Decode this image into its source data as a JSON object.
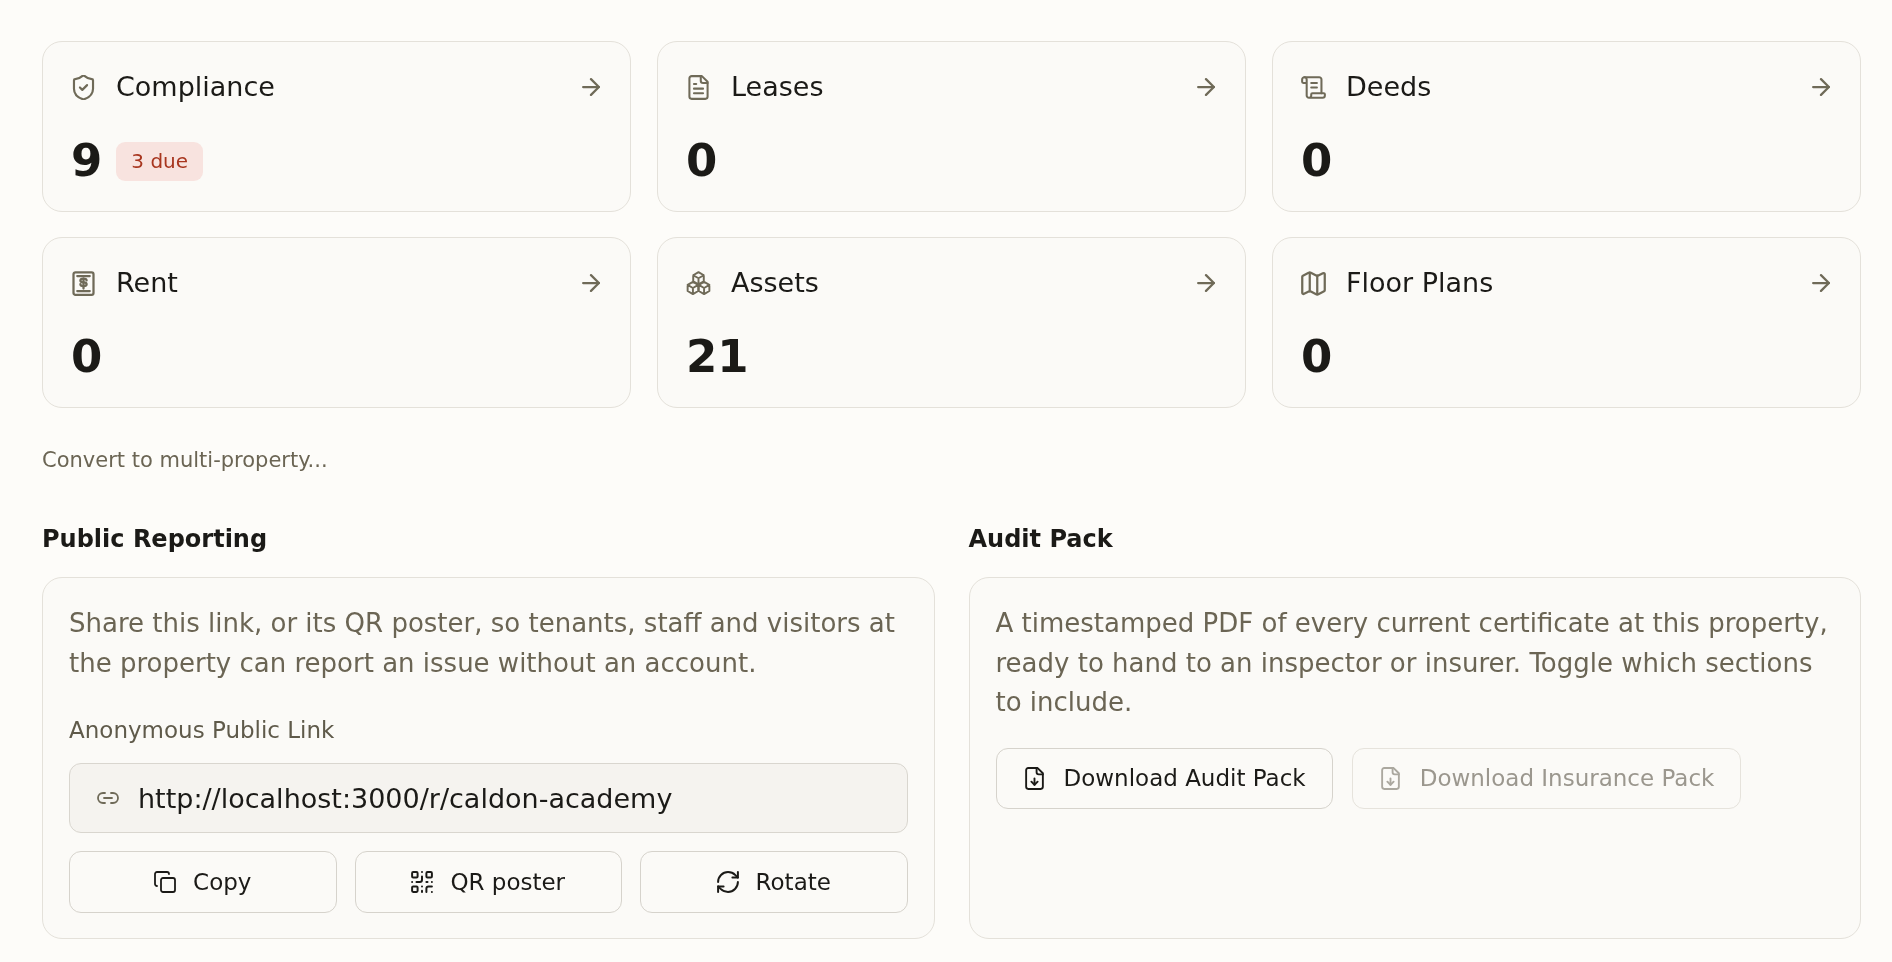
{
  "stat_cards": [
    {
      "title": "Compliance",
      "count": "9",
      "badge": "3 due"
    },
    {
      "title": "Leases",
      "count": "0"
    },
    {
      "title": "Deeds",
      "count": "0"
    },
    {
      "title": "Rent",
      "count": "0"
    },
    {
      "title": "Assets",
      "count": "21"
    },
    {
      "title": "Floor Plans",
      "count": "0"
    }
  ],
  "convert_link": "Convert to multi-property...",
  "public_reporting": {
    "heading": "Public Reporting",
    "description": "Share this link, or its QR poster, so tenants, staff and visitors at the property can report an issue without an account.",
    "field_label": "Anonymous Public Link",
    "link_field": {
      "value": "http://localhost:3000/r/caldon-academy"
    },
    "buttons": [
      {
        "label": "Copy"
      },
      {
        "label": "QR poster"
      },
      {
        "label": "Rotate"
      }
    ]
  },
  "audit_pack": {
    "heading": "Audit Pack",
    "description": "A timestamped PDF of every current certificate at this property, ready to hand to an inspector or insurer. Toggle which sections to include.",
    "buttons": [
      {
        "label": "Download Audit Pack",
        "disabled": false
      },
      {
        "label": "Download Insurance Pack",
        "disabled": true
      }
    ]
  }
}
